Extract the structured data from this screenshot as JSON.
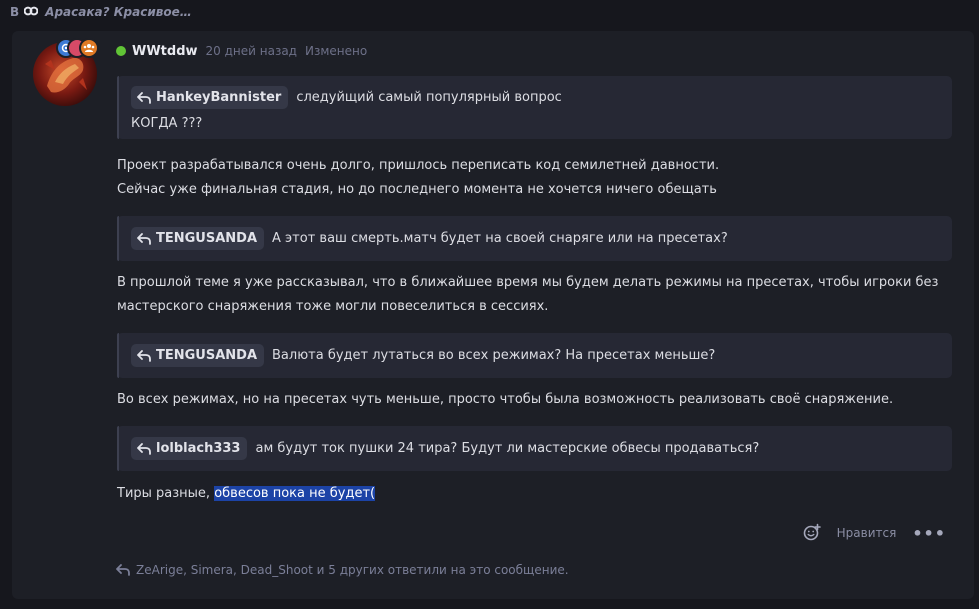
{
  "topic": {
    "prefix": "В",
    "title": "Арасака? Красивое…"
  },
  "post": {
    "author": "WWtddw",
    "time": "20 дней назад",
    "edited": "Изменено",
    "quotes": [
      {
        "user": "HankeyBannister",
        "line1": "следуйщий самый популярный вопрос",
        "line2": "КОГДА ???"
      },
      {
        "user": "TENGUSANDA",
        "line1": "А этот ваш смерть.матч будет на своей снаряге или на пресетах?"
      },
      {
        "user": "TENGUSANDA",
        "line1": "Валюта будет лутаться во всех режимах? На пресетах меньше?"
      },
      {
        "user": "lolblach333",
        "line1": "ам будут ток пушки 24 тира? Будут ли мастерские обвесы продаваться?"
      }
    ],
    "paragraphs": {
      "p1_line1": "Проект разрабатывался очень долго, пришлось переписать код семилетней давности.",
      "p1_line2": "Сейчас уже финальная стадия, но до последнего момента не хочется ничего обещать",
      "p2_line1": "В прошлой теме я уже рассказывал, что в ближайшее время мы будем делать режимы на пресетах, чтобы игроки без",
      "p2_line2": "мастерского снаряжения тоже могли повеселиться в сессиях.",
      "p3": "Во всех режимах, но на пресетах чуть меньше, просто чтобы была возможность реализовать своё снаряжение.",
      "p4_plain": "Тиры разные, ",
      "p4_selected": "обвесов пока не будет("
    },
    "actions": {
      "like": "Нравится",
      "more": "•••"
    },
    "replies_text": "ZeArige, Simera, Dead_Shoot и 5 других ответили на это сообщение."
  },
  "colors": {
    "background": "#16171d",
    "card": "#1d1f26",
    "quote": "#262834",
    "online": "#61c436",
    "selection": "#1c43a6"
  },
  "icons": {
    "reply": "reply-arrow-icon",
    "reaction": "add-reaction-icon",
    "mask": "mask-icon"
  }
}
